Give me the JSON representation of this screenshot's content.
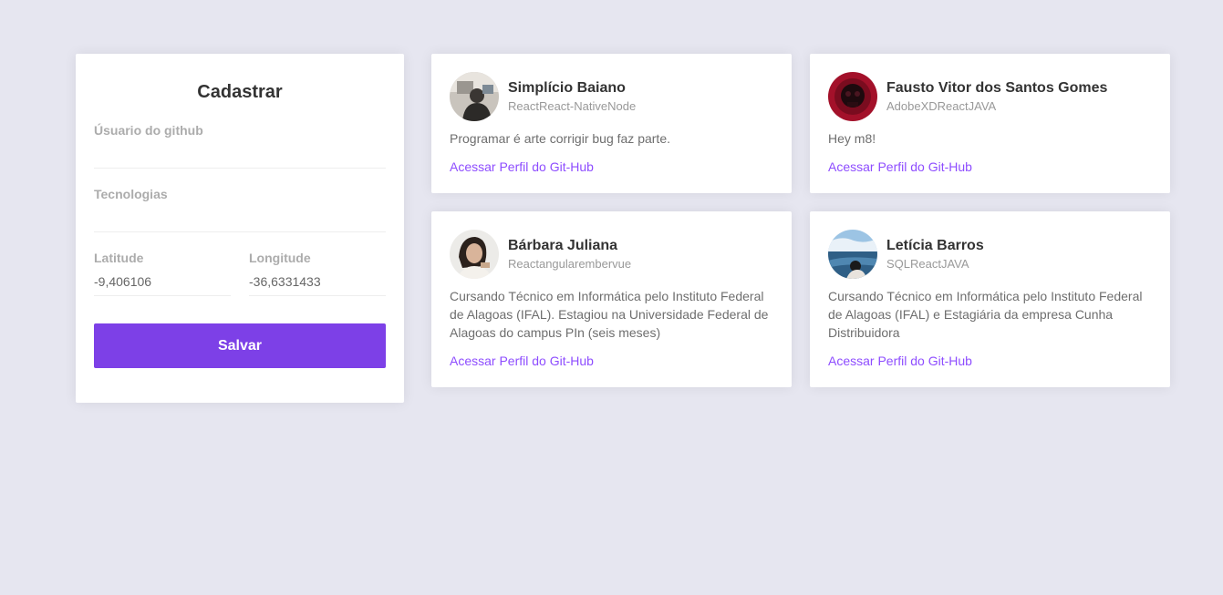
{
  "form": {
    "title": "Cadastrar",
    "github_username": {
      "label": "Úsuario do github",
      "value": ""
    },
    "techs": {
      "label": "Tecnologias",
      "value": ""
    },
    "latitude": {
      "label": "Latitude",
      "value": "-9,406106"
    },
    "longitude": {
      "label": "Longitude",
      "value": "-36,6331433"
    },
    "submit_label": "Salvar",
    "accent_color": "#7d40e7"
  },
  "devs": [
    {
      "name": "Simplício Baiano",
      "techs": "ReactReact-NativeNode",
      "bio": "Programar é arte corrigir bug faz parte.",
      "link_label": "Acessar Perfil do Git-Hub"
    },
    {
      "name": "Fausto Vitor dos Santos Gomes",
      "techs": "AdobeXDReactJAVA",
      "bio": "Hey m8!",
      "link_label": "Acessar Perfil do Git-Hub"
    },
    {
      "name": "Bárbara Juliana",
      "techs": "Reactangularembervue",
      "bio": "Cursando Técnico em Informática pelo Instituto Federal de Alagoas (IFAL). Estagiou na Universidade Federal de Alagoas do campus PIn (seis meses)",
      "link_label": "Acessar Perfil do Git-Hub"
    },
    {
      "name": "Letícia Barros",
      "techs": "SQLReactJAVA",
      "bio": "Cursando Técnico em Informática pelo Instituto Federal de Alagoas (IFAL) e Estagiária da empresa Cunha Distribuidora",
      "link_label": "Acessar Perfil do Git-Hub"
    }
  ],
  "link_color": "#8e4dff"
}
